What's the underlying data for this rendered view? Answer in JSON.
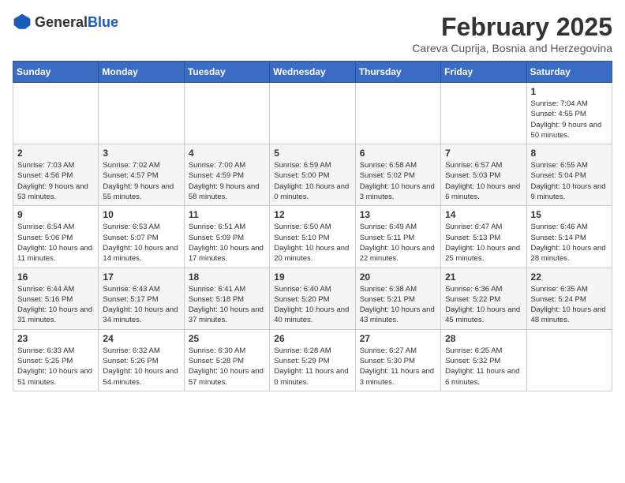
{
  "header": {
    "logo": {
      "general": "General",
      "blue": "Blue"
    },
    "month": "February 2025",
    "location": "Careva Cuprija, Bosnia and Herzegovina"
  },
  "calendar": {
    "weekdays": [
      "Sunday",
      "Monday",
      "Tuesday",
      "Wednesday",
      "Thursday",
      "Friday",
      "Saturday"
    ],
    "weeks": [
      [
        {
          "day": "",
          "info": ""
        },
        {
          "day": "",
          "info": ""
        },
        {
          "day": "",
          "info": ""
        },
        {
          "day": "",
          "info": ""
        },
        {
          "day": "",
          "info": ""
        },
        {
          "day": "",
          "info": ""
        },
        {
          "day": "1",
          "info": "Sunrise: 7:04 AM\nSunset: 4:55 PM\nDaylight: 9 hours\nand 50 minutes."
        }
      ],
      [
        {
          "day": "2",
          "info": "Sunrise: 7:03 AM\nSunset: 4:56 PM\nDaylight: 9 hours\nand 53 minutes."
        },
        {
          "day": "3",
          "info": "Sunrise: 7:02 AM\nSunset: 4:57 PM\nDaylight: 9 hours\nand 55 minutes."
        },
        {
          "day": "4",
          "info": "Sunrise: 7:00 AM\nSunset: 4:59 PM\nDaylight: 9 hours\nand 58 minutes."
        },
        {
          "day": "5",
          "info": "Sunrise: 6:59 AM\nSunset: 5:00 PM\nDaylight: 10 hours\nand 0 minutes."
        },
        {
          "day": "6",
          "info": "Sunrise: 6:58 AM\nSunset: 5:02 PM\nDaylight: 10 hours\nand 3 minutes."
        },
        {
          "day": "7",
          "info": "Sunrise: 6:57 AM\nSunset: 5:03 PM\nDaylight: 10 hours\nand 6 minutes."
        },
        {
          "day": "8",
          "info": "Sunrise: 6:55 AM\nSunset: 5:04 PM\nDaylight: 10 hours\nand 9 minutes."
        }
      ],
      [
        {
          "day": "9",
          "info": "Sunrise: 6:54 AM\nSunset: 5:06 PM\nDaylight: 10 hours\nand 11 minutes."
        },
        {
          "day": "10",
          "info": "Sunrise: 6:53 AM\nSunset: 5:07 PM\nDaylight: 10 hours\nand 14 minutes."
        },
        {
          "day": "11",
          "info": "Sunrise: 6:51 AM\nSunset: 5:09 PM\nDaylight: 10 hours\nand 17 minutes."
        },
        {
          "day": "12",
          "info": "Sunrise: 6:50 AM\nSunset: 5:10 PM\nDaylight: 10 hours\nand 20 minutes."
        },
        {
          "day": "13",
          "info": "Sunrise: 6:49 AM\nSunset: 5:11 PM\nDaylight: 10 hours\nand 22 minutes."
        },
        {
          "day": "14",
          "info": "Sunrise: 6:47 AM\nSunset: 5:13 PM\nDaylight: 10 hours\nand 25 minutes."
        },
        {
          "day": "15",
          "info": "Sunrise: 6:46 AM\nSunset: 5:14 PM\nDaylight: 10 hours\nand 28 minutes."
        }
      ],
      [
        {
          "day": "16",
          "info": "Sunrise: 6:44 AM\nSunset: 5:16 PM\nDaylight: 10 hours\nand 31 minutes."
        },
        {
          "day": "17",
          "info": "Sunrise: 6:43 AM\nSunset: 5:17 PM\nDaylight: 10 hours\nand 34 minutes."
        },
        {
          "day": "18",
          "info": "Sunrise: 6:41 AM\nSunset: 5:18 PM\nDaylight: 10 hours\nand 37 minutes."
        },
        {
          "day": "19",
          "info": "Sunrise: 6:40 AM\nSunset: 5:20 PM\nDaylight: 10 hours\nand 40 minutes."
        },
        {
          "day": "20",
          "info": "Sunrise: 6:38 AM\nSunset: 5:21 PM\nDaylight: 10 hours\nand 43 minutes."
        },
        {
          "day": "21",
          "info": "Sunrise: 6:36 AM\nSunset: 5:22 PM\nDaylight: 10 hours\nand 45 minutes."
        },
        {
          "day": "22",
          "info": "Sunrise: 6:35 AM\nSunset: 5:24 PM\nDaylight: 10 hours\nand 48 minutes."
        }
      ],
      [
        {
          "day": "23",
          "info": "Sunrise: 6:33 AM\nSunset: 5:25 PM\nDaylight: 10 hours\nand 51 minutes."
        },
        {
          "day": "24",
          "info": "Sunrise: 6:32 AM\nSunset: 5:26 PM\nDaylight: 10 hours\nand 54 minutes."
        },
        {
          "day": "25",
          "info": "Sunrise: 6:30 AM\nSunset: 5:28 PM\nDaylight: 10 hours\nand 57 minutes."
        },
        {
          "day": "26",
          "info": "Sunrise: 6:28 AM\nSunset: 5:29 PM\nDaylight: 11 hours\nand 0 minutes."
        },
        {
          "day": "27",
          "info": "Sunrise: 6:27 AM\nSunset: 5:30 PM\nDaylight: 11 hours\nand 3 minutes."
        },
        {
          "day": "28",
          "info": "Sunrise: 6:25 AM\nSunset: 5:32 PM\nDaylight: 11 hours\nand 6 minutes."
        },
        {
          "day": "",
          "info": ""
        }
      ]
    ]
  }
}
